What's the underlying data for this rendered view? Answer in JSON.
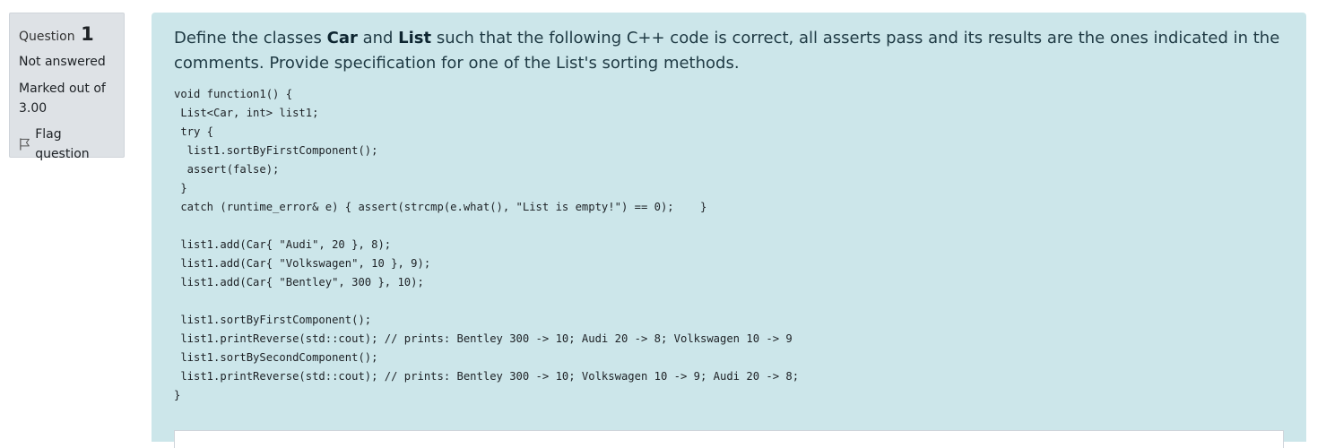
{
  "info": {
    "question_prefix": "Question",
    "question_number": "1",
    "state": "Not answered",
    "grade_line1": "Marked out of",
    "grade_line2": "3.00",
    "flag_label": "Flag question",
    "flag_icon": "flag-outline-icon"
  },
  "question": {
    "text_part1": "Define the classes ",
    "bold1": "Car",
    "text_part2": " and ",
    "bold2": "List",
    "text_part3": " such that the following C++ code is correct, all asserts pass and its results are the ones indicated in the comments. Provide specification for one of the List's sorting methods.",
    "code": "void function1() {\n List<Car, int> list1;\n try {\n  list1.sortByFirstComponent();\n  assert(false);\n }\n catch (runtime_error& e) { assert(strcmp(e.what(), \"List is empty!\") == 0);    }\n\n list1.add(Car{ \"Audi\", 20 }, 8);\n list1.add(Car{ \"Volkswagen\", 10 }, 9);\n list1.add(Car{ \"Bentley\", 300 }, 10);\n\n list1.sortByFirstComponent();\n list1.printReverse(std::cout); // prints: Bentley 300 -> 10; Audi 20 -> 8; Volkswagen 10 -> 9\n list1.sortBySecondComponent();\n list1.printReverse(std::cout); // prints: Bentley 300 -> 10; Volkswagen 10 -> 9; Audi 20 -> 8;\n}"
  },
  "answer": {
    "value": ""
  },
  "colors": {
    "info_bg": "#dee2e6",
    "content_bg": "#cce6ea"
  }
}
